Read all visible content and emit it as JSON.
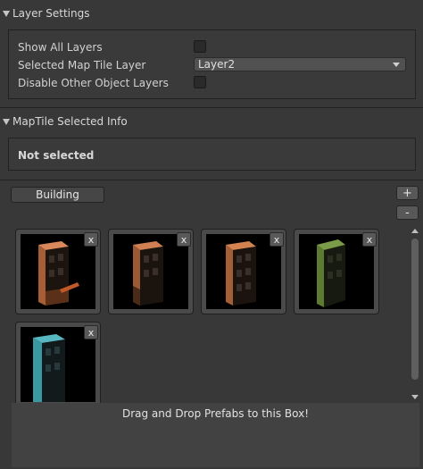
{
  "layer_settings": {
    "header": "Layer Settings",
    "show_all_layers_label": "Show All Layers",
    "show_all_layers_checked": false,
    "selected_map_tile_layer_label": "Selected Map Tile Layer",
    "selected_map_tile_layer_value": "Layer2",
    "disable_other_object_layers_label": "Disable Other Object Layers",
    "disable_other_object_layers_checked": false
  },
  "maptile_info": {
    "header": "MapTile Selected Info",
    "status": "Not selected"
  },
  "palette": {
    "category_label": "Building",
    "add_label": "+",
    "remove_label": "-",
    "tiles": [
      {
        "name": "building-orange-1",
        "color": "#c8774a",
        "remove_label": "x"
      },
      {
        "name": "building-orange-2",
        "color": "#bf7046",
        "remove_label": "x"
      },
      {
        "name": "building-orange-3",
        "color": "#c27548",
        "remove_label": "x"
      },
      {
        "name": "building-green",
        "color": "#6a8c3c",
        "remove_label": "x"
      },
      {
        "name": "building-teal",
        "color": "#3fa2ad",
        "remove_label": "x"
      }
    ],
    "drop_hint": "Drag and Drop Prefabs to this Box!"
  }
}
